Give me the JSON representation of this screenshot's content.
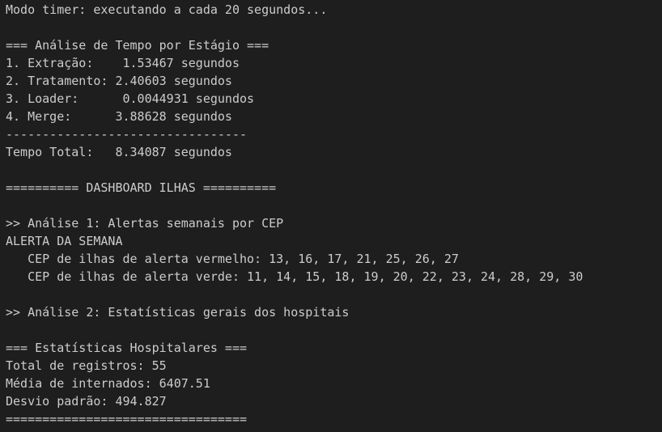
{
  "terminal": {
    "lines": [
      "Modo timer: executando a cada 20 segundos...",
      "",
      "=== Análise de Tempo por Estágio ===",
      "1. Extração:    1.53467 segundos",
      "2. Tratamento: 2.40603 segundos",
      "3. Loader:      0.0044931 segundos",
      "4. Merge:      3.88628 segundos",
      "---------------------------------",
      "Tempo Total:   8.34087 segundos",
      "",
      "========== DASHBOARD ILHAS ==========",
      "",
      ">> Análise 1: Alertas semanais por CEP",
      "ALERTA DA SEMANA",
      "   CEP de ilhas de alerta vermelho: 13, 16, 17, 21, 25, 26, 27",
      "   CEP de ilhas de alerta verde: 11, 14, 15, 18, 19, 20, 22, 23, 24, 28, 29, 30",
      "",
      ">> Análise 2: Estatísticas gerais dos hospitais",
      "",
      "=== Estatísticas Hospitalares ===",
      "Total de registros: 55",
      "Média de internados: 6407.51",
      "Desvio padrão: 494.827",
      "================================="
    ]
  }
}
